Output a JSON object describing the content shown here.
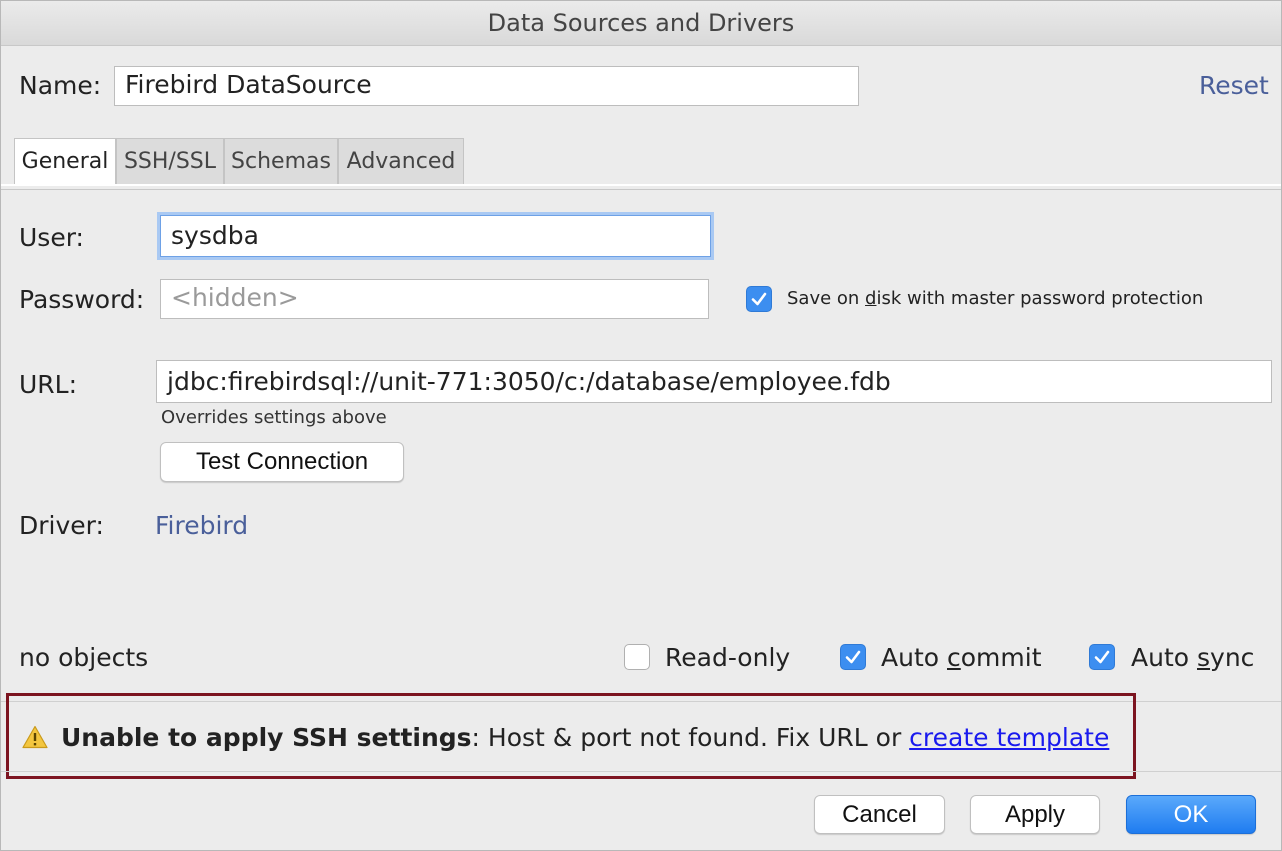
{
  "window": {
    "title": "Data Sources and Drivers"
  },
  "name_row": {
    "label": "Name:",
    "value": "Firebird DataSource",
    "reset_label": "Reset"
  },
  "tabs": [
    {
      "label": "General",
      "active": true
    },
    {
      "label": "SSH/SSL",
      "active": false
    },
    {
      "label": "Schemas",
      "active": false
    },
    {
      "label": "Advanced",
      "active": false
    }
  ],
  "user": {
    "label": "User:",
    "value": "sysdba"
  },
  "password": {
    "label": "Password:",
    "placeholder": "<hidden>",
    "save_checkbox": {
      "label_before": "Save on ",
      "label_mnemonic": "d",
      "label_after": "isk with master password protection",
      "checked": true
    }
  },
  "url": {
    "label": "URL:",
    "value": "jdbc:firebirdsql://unit-771:3050/c:/database/employee.fdb",
    "hint": "Overrides settings above"
  },
  "test_connection_label": "Test Connection",
  "driver": {
    "label": "Driver:",
    "value": "Firebird"
  },
  "status": {
    "objects": "no objects"
  },
  "options": {
    "read_only": {
      "label": "Read-only",
      "checked": false
    },
    "auto_commit": {
      "label_before": "Auto ",
      "label_mnemonic": "c",
      "label_after": "ommit",
      "checked": true
    },
    "auto_sync": {
      "label_before": "Auto ",
      "label_mnemonic": "s",
      "label_after": "ync",
      "checked": true
    }
  },
  "warning": {
    "icon": "warning-icon",
    "title": "Unable to apply SSH settings",
    "message": ": Host & port not found. Fix URL or ",
    "link": "create template"
  },
  "footer": {
    "cancel_label": "Cancel",
    "apply_label": "Apply",
    "ok_label": "OK"
  },
  "colors": {
    "accent": "#1f7cf0",
    "link": "#4a5f9a",
    "warning_border": "#7c1420"
  }
}
